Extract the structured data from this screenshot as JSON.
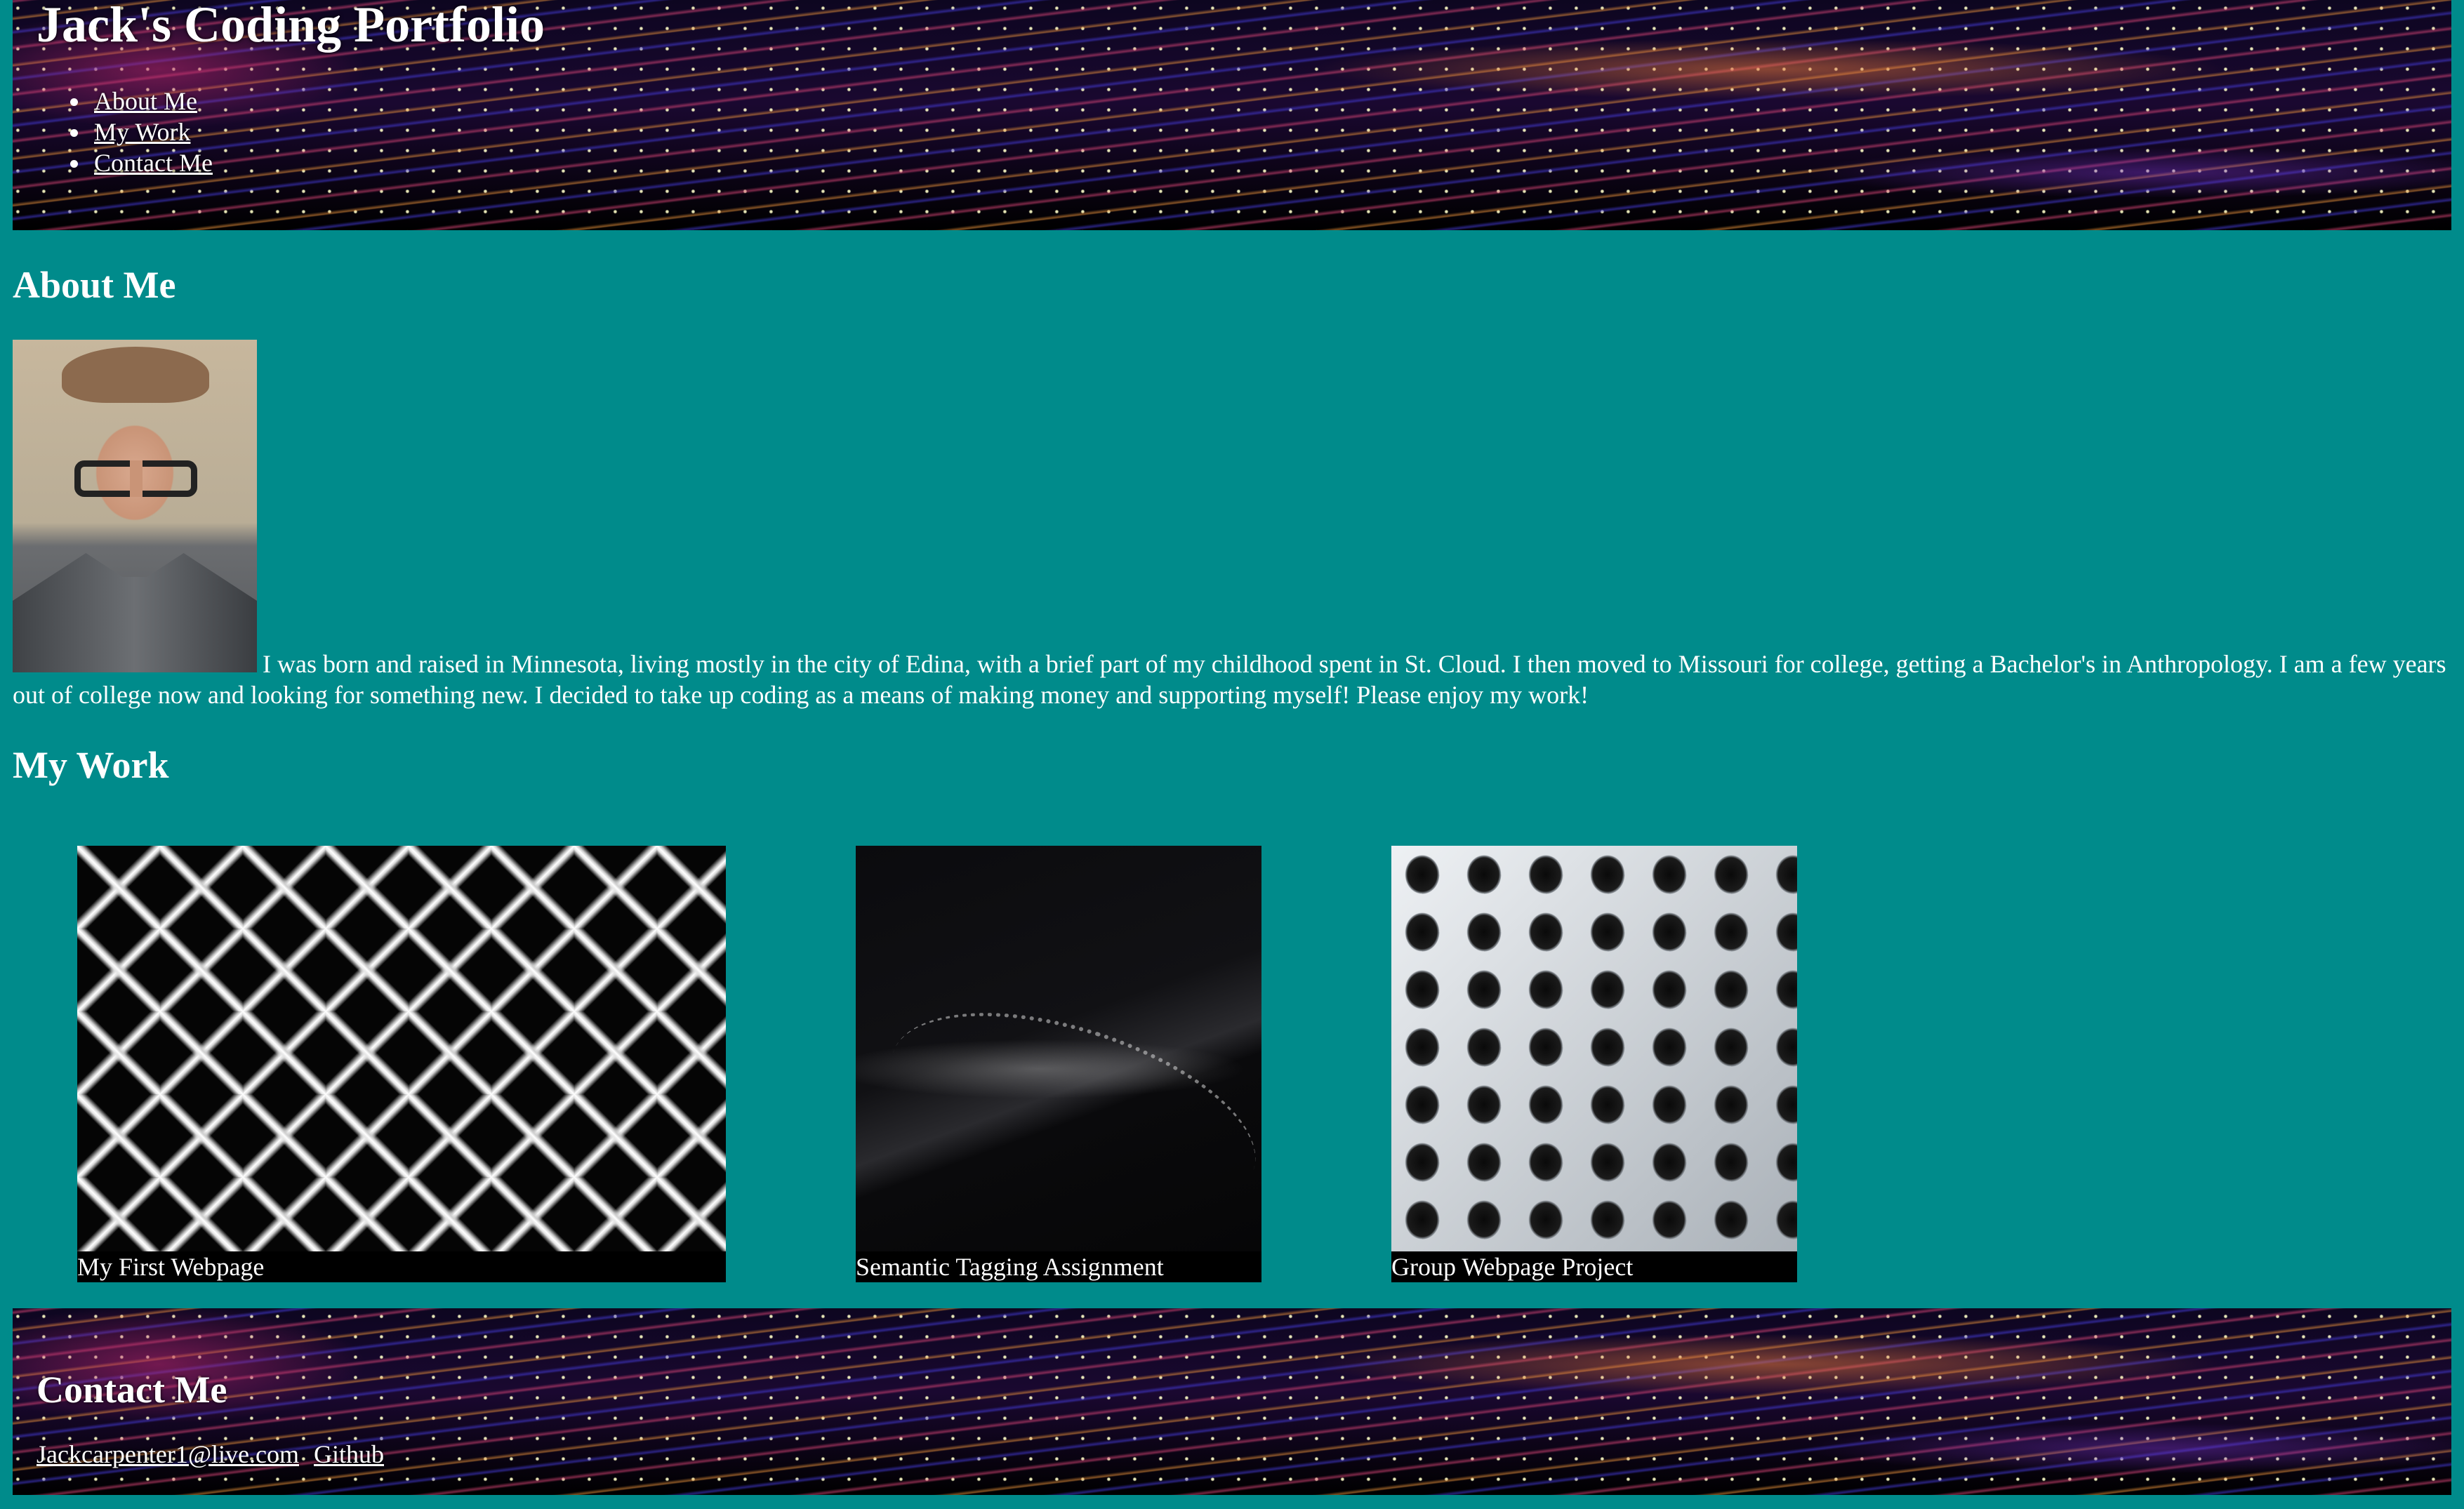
{
  "header": {
    "title": "Jack's Coding Portfolio",
    "nav": [
      {
        "label": "About Me"
      },
      {
        "label": "My Work"
      },
      {
        "label": "Contact Me"
      }
    ]
  },
  "about": {
    "heading": "About Me",
    "photo_alt": "profile photo",
    "text": "I was born and raised in Minnesota, living mostly in the city of Edina, with a brief part of my childhood spent in St. Cloud. I then moved to Missouri for college, getting a Bachelor's in Anthropology. I am a few years out of college now and looking for something new. I decided to take up coding as a means of making money and supporting myself! Please enjoy my work!"
  },
  "work": {
    "heading": "My Work",
    "projects": [
      {
        "caption": "My First Webpage"
      },
      {
        "caption": "Semantic Tagging Assignment"
      },
      {
        "caption": "Group Webpage Project"
      }
    ]
  },
  "footer": {
    "heading": "Contact Me",
    "links": [
      {
        "label": "Jackcarpenter1@live.com"
      },
      {
        "label": "Github"
      }
    ]
  },
  "colors": {
    "page_background": "#008b8b",
    "text": "#ffffff",
    "caption_background": "#000000"
  }
}
